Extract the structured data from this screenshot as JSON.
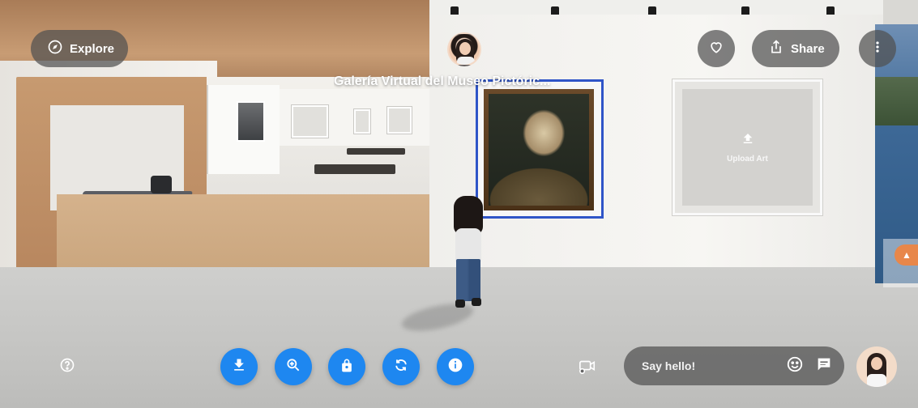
{
  "header": {
    "explore_label": "Explore",
    "gallery_title": "Galería Virtual del Museo Pictóric...",
    "share_label": "Share"
  },
  "artwork": {
    "placeholder_label": "Upload Art"
  },
  "toolbar": {
    "tools": [
      {
        "icon": "download-icon",
        "name": "download"
      },
      {
        "icon": "zoom-in-icon",
        "name": "zoom"
      },
      {
        "icon": "lock-icon",
        "name": "lock"
      },
      {
        "icon": "sync-icon",
        "name": "rotate"
      },
      {
        "icon": "info-icon",
        "name": "info"
      }
    ],
    "accent_color": "#1e87f0"
  },
  "chat": {
    "placeholder": "Say hello!"
  },
  "icons": {
    "explore": "compass-icon",
    "like": "heart-icon",
    "share": "share-icon",
    "more": "more-vertical-icon",
    "help": "help-icon",
    "camera": "camera-switch-icon",
    "emoji": "emoji-icon",
    "chat": "chat-icon"
  }
}
